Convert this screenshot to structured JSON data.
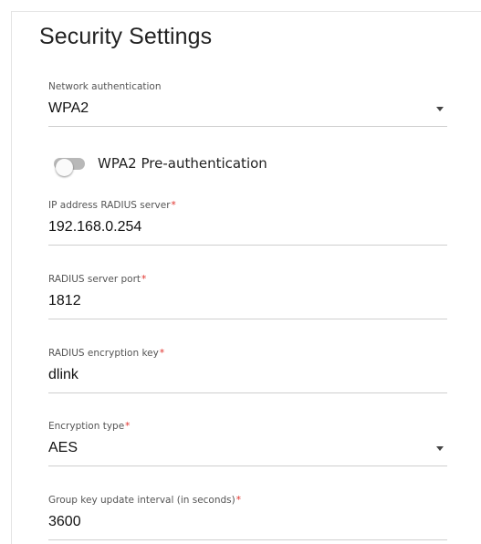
{
  "title": "Security Settings",
  "network_auth": {
    "label": "Network authentication",
    "value": "WPA2"
  },
  "preauth": {
    "label": "WPA2 Pre-authentication",
    "enabled": false
  },
  "radius_ip": {
    "label": "IP address RADIUS server",
    "required_mark": "*",
    "value": "192.168.0.254"
  },
  "radius_port": {
    "label": "RADIUS server port",
    "required_mark": "*",
    "value": "1812"
  },
  "radius_key": {
    "label": "RADIUS encryption key",
    "required_mark": "*",
    "value": "dlink"
  },
  "encryption": {
    "label": "Encryption type",
    "required_mark": "*",
    "value": "AES"
  },
  "group_key": {
    "label": "Group key update interval (in seconds)",
    "required_mark": "*",
    "value": "3600"
  },
  "icons": {
    "dropdown": "chevron-down-icon"
  },
  "colors": {
    "required": "#e0302a",
    "underline": "#cfcfcf",
    "toggle_off": "#b8b8b8"
  }
}
